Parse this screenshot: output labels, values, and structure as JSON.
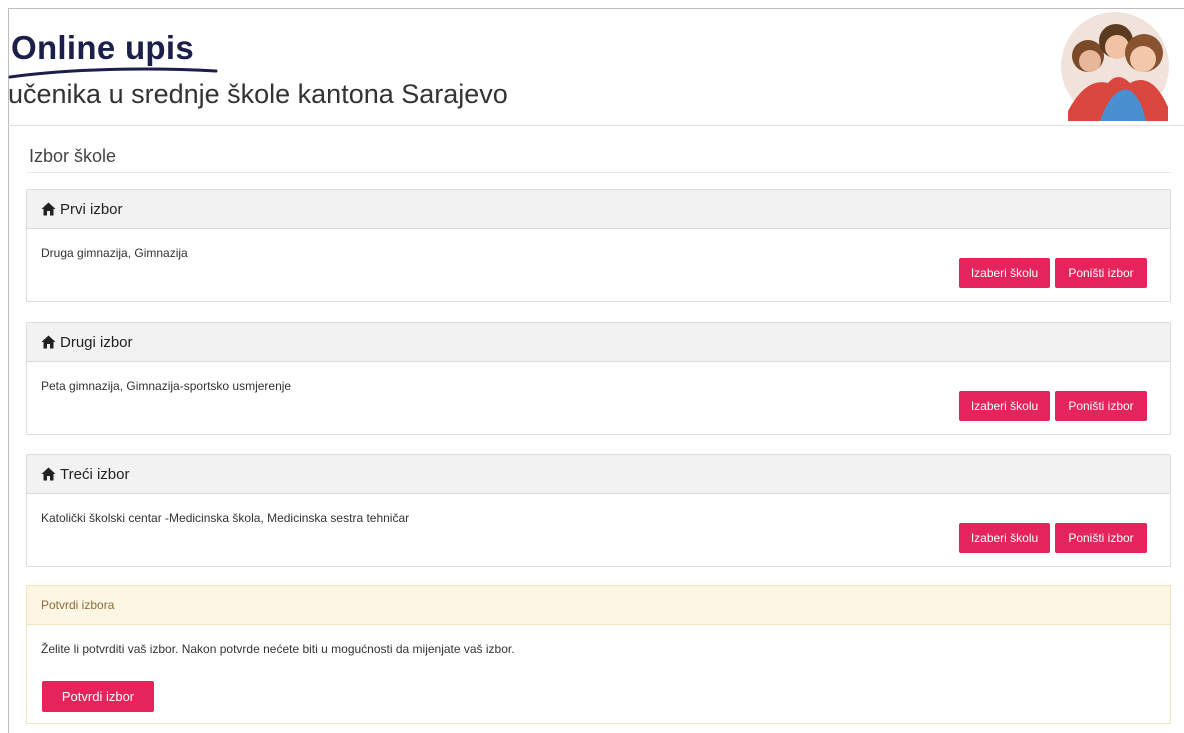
{
  "header": {
    "logo_title": "Online upis",
    "logo_subtitle": "učenika u srednje škole kantona Sarajevo",
    "image_icon": "students-photo"
  },
  "section_title": "Izbor škole",
  "choices": [
    {
      "heading": "Prvi izbor",
      "icon": "home-icon",
      "school": "Druga gimnazija, Gimnazija",
      "select_label": "Izaberi školu",
      "cancel_label": "Poništi izbor"
    },
    {
      "heading": "Drugi izbor",
      "icon": "home-icon",
      "school": "Peta gimnazija, Gimnazija-sportsko usmjerenje",
      "select_label": "Izaberi školu",
      "cancel_label": "Poništi izbor"
    },
    {
      "heading": "Treći izbor",
      "icon": "home-icon",
      "school": "Katolički školski centar -Medicinska škola, Medicinska sestra tehničar",
      "select_label": "Izaberi školu",
      "cancel_label": "Poništi izbor"
    }
  ],
  "confirm": {
    "heading": "Potvrdi izbora",
    "message": "Želite li potvrditi vaš izbor. Nakon potvrde nećete biti u mogućnosti da mijenjate vaš izbor.",
    "button_label": "Potvrdi izbor"
  },
  "colors": {
    "accent": "#e5245b",
    "panel_header": "#f2f2f2",
    "confirm_header": "#fcf6e2",
    "logo": "#1b1f4a"
  }
}
